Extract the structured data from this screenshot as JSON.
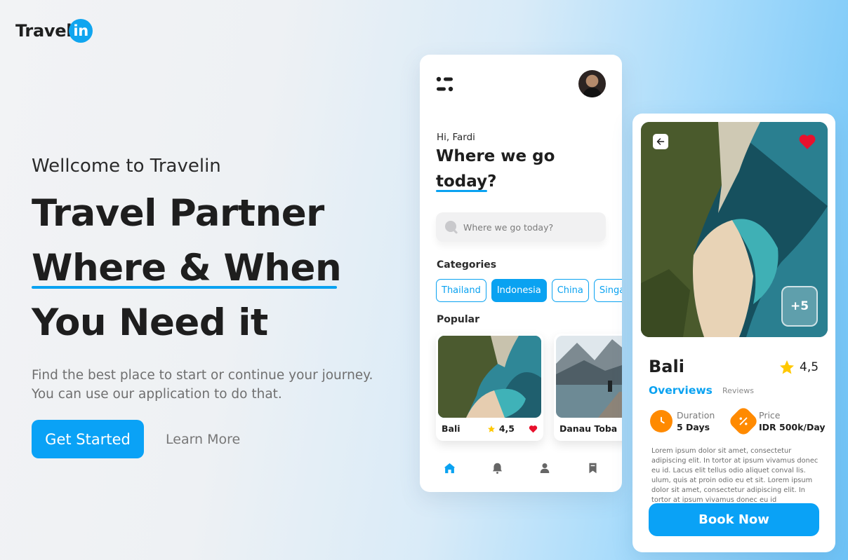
{
  "brand": {
    "name_prefix": "Travel",
    "name_suffix": "in"
  },
  "hero": {
    "welcome": "Wellcome to Travelin",
    "headline_line1": "Travel Partner",
    "headline_line2": "Where & When",
    "headline_line3": "You Need it",
    "description_line1": "Find the best place to start or continue your journey.",
    "description_line2": "You can use our application to do that.",
    "primary_cta": "Get Started",
    "secondary_cta": "Learn More"
  },
  "home_screen": {
    "greeting": "Hi, Fardi",
    "question_line1": "Where we go",
    "question_word": "today",
    "question_mark": "?",
    "search_placeholder": "Where we go today?",
    "categories_title": "Categories",
    "categories": [
      {
        "label": "Thailand",
        "active": false
      },
      {
        "label": "Indonesia",
        "active": true
      },
      {
        "label": "China",
        "active": false
      },
      {
        "label": "Singapore",
        "active": false
      }
    ],
    "popular_title": "Popular",
    "popular": [
      {
        "name": "Bali",
        "rating": "4,5",
        "favorite": true
      },
      {
        "name": "Danau Toba"
      }
    ],
    "tabs": [
      "home-icon",
      "bell-icon",
      "user-icon",
      "bookmark-icon"
    ]
  },
  "detail_screen": {
    "more_photos": "+5",
    "place": "Bali",
    "rating": "4,5",
    "tab_overviews": "Overviews",
    "tab_reviews": "Reviews",
    "duration_label": "Duration",
    "duration_value": "5 Days",
    "price_label": "Price",
    "price_value": "IDR 500k/Day",
    "description": "Lorem ipsum dolor sit amet, consectetur adipiscing elit. In tortor at ipsum vivamus donec eu id. Lacus elit tellus odio aliquet conval lis. ulum, quis at proin odio eu et sit. Lorem ipsum dolor sit amet, consectetur adipiscing elit. In tortor at ipsum vivamus donec eu id",
    "book_button": "Book Now"
  },
  "colors": {
    "accent": "#0AA2F1",
    "orange": "#FF8A00",
    "heart": "#E8112D",
    "star": "#FFC800"
  }
}
